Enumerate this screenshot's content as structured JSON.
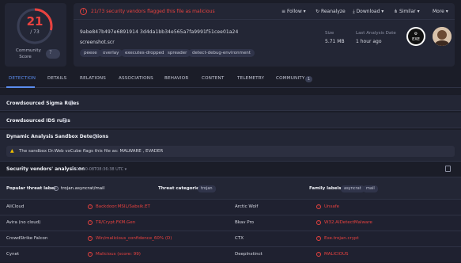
{
  "score": {
    "detected": "21",
    "total": "/ 73",
    "community_label": "Community Score",
    "community_value": "?"
  },
  "banner": {
    "icon": "!",
    "text": "21/73 security vendors flagged this file as malicious"
  },
  "actions": [
    "Follow ▾",
    "Reanalyze",
    "Download ▾",
    "Similar ▾",
    "More ▾"
  ],
  "file": {
    "hash": "9abe847b497e6891914 3d4da1bb34e565a7fa9991f51cee01a24",
    "name": "screenshot.scr",
    "tags": [
      "peexe",
      "overlay",
      "executes-dropped-file",
      "spreader",
      "detect-debug-environment"
    ],
    "size_label": "Size",
    "size_value": "5.71 MB",
    "date_label": "Last Analysis Date",
    "date_value": "1 hour ago",
    "type_icon": "EXE"
  },
  "tabs": [
    "DETECTION",
    "DETAILS",
    "RELATIONS",
    "ASSOCIATIONS",
    "BEHAVIOR",
    "CONTENT",
    "TELEMETRY",
    "COMMUNITY"
  ],
  "community_count": "1",
  "sections": {
    "sigma": "Crowdsourced Sigma Rules",
    "ids": "Crowdsourced IDS rules",
    "sandbox": "Dynamic Analysis Sandbox Detections",
    "sandbox_alert": "The sandbox Dr.Web vxCube flags this file as: MALWARE , EVADER"
  },
  "vendors": {
    "title": "Security vendors' analysis on",
    "date": "2025-10-08T08:36:38 UTC ▾",
    "threat_label_title": "Popular threat label",
    "threat_label_value": "trojan.asyncrat/mail",
    "categories_title": "Threat categories",
    "categories": [
      "trojan"
    ],
    "family_title": "Family labels",
    "families": [
      "asyncrat",
      "mail"
    ],
    "rows": [
      {
        "left_name": "AliCloud",
        "left_result": "Backdoor:MSIL/Sabsik.ET",
        "right_name": "Arctic Wolf",
        "right_result": "Unsafe"
      },
      {
        "left_name": "Avira (no cloud)",
        "left_result": "TR/Crypt.FKM.Gen",
        "right_name": "Bkav Pro",
        "right_result": "W32.AIDetectMalware"
      },
      {
        "left_name": "CrowdStrike Falcon",
        "left_result": "Win/malicious_confidence_60% (D)",
        "right_name": "CTX",
        "right_result": "Exe.trojan.crypt"
      },
      {
        "left_name": "Cynet",
        "left_result": "Malicious (score: 99)",
        "right_name": "DeepInstinct",
        "right_result": "MALICIOUS"
      }
    ]
  },
  "colors": {
    "accent": "#5b8def",
    "danger": "#e8423f",
    "background": "#1b1d28"
  }
}
